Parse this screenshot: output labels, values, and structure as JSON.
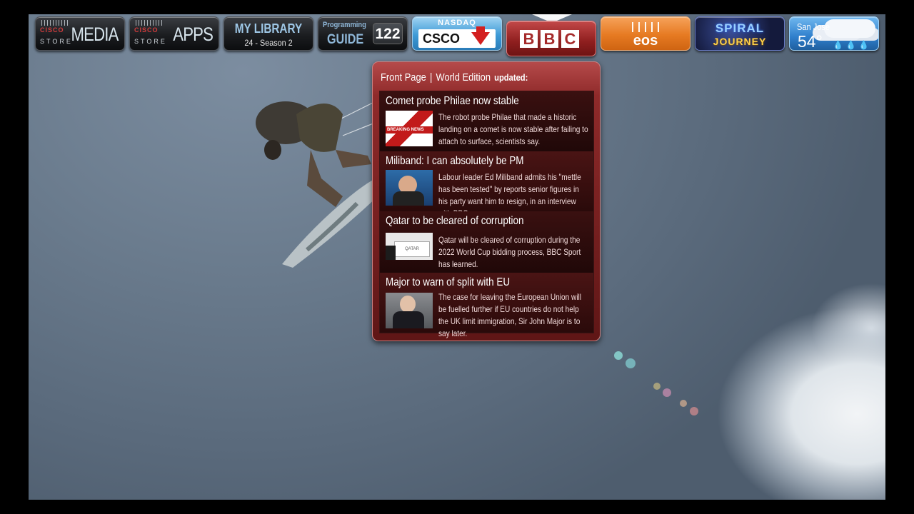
{
  "top_bar": {
    "tiles": [
      {
        "id": "cisco-media",
        "brand": "cisco",
        "sub": "STORE",
        "label": "MEDIA"
      },
      {
        "id": "cisco-apps",
        "brand": "cisco",
        "sub": "STORE",
        "label": "APPS"
      },
      {
        "id": "my-library",
        "title": "MY LIBRARY",
        "subtitle": "24 - Season 2"
      },
      {
        "id": "programming-guide",
        "line1": "Programming",
        "line2": "GUIDE",
        "channel": "122"
      },
      {
        "id": "nasdaq",
        "exchange": "NASDAQ",
        "symbol": "CSCO",
        "trend": "down"
      },
      {
        "id": "bbc",
        "letters": [
          "B",
          "B",
          "C"
        ]
      },
      {
        "id": "eos",
        "label": "eos"
      },
      {
        "id": "spiral-journey",
        "line1": "SPIRAL",
        "line2": "JOURNEY"
      },
      {
        "id": "weather",
        "city": "San Jose",
        "temp": "54°",
        "condition": "rain"
      }
    ]
  },
  "news_panel": {
    "tabs": [
      "Front Page",
      "World Edition"
    ],
    "separator": "|",
    "updated_label": "updated:",
    "items": [
      {
        "title": "Comet probe Philae now stable",
        "description": "The robot probe Philae that made a historic landing on a comet is now stable after failing to attach to surface, scientists say.",
        "thumb_label": "BREAKING NEWS"
      },
      {
        "title": "Miliband: I can absolutely be PM",
        "description": "Labour leader Ed Miliband admits his \"mettle has been tested\" by reports senior figures in his party want him to resign, in an interview with BBC"
      },
      {
        "title": "Qatar to be cleared of corruption",
        "description": "Qatar will be cleared of corruption during the 2022 World Cup bidding process, BBC Sport has learned.",
        "thumb_label": "QATAR"
      },
      {
        "title": "Major to warn of split with EU",
        "description": "The case for leaving the European Union will be fuelled further if EU countries do not help the UK limit immigration, Sir John Major is to say later."
      }
    ]
  },
  "colors": {
    "accent": "#8f2a2a",
    "nasdaq_down": "#d31f1f",
    "eos": "#e67a22",
    "weather": "#2f7fcc"
  }
}
